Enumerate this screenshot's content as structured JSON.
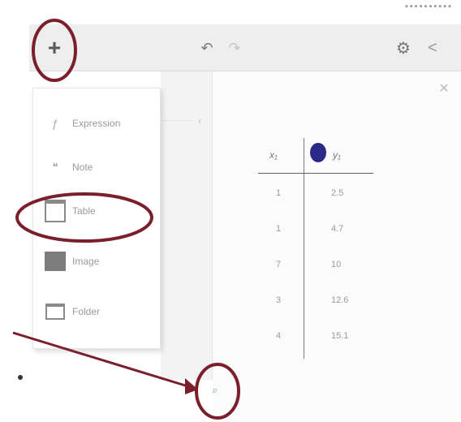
{
  "window": {
    "top_strip_text": "▪▪▪▪▪▪▪▪▪▪"
  },
  "toolbar": {
    "plus_icon": "plus-icon",
    "undo_icon": "undo-icon",
    "redo_icon": "redo-icon",
    "settings_icon": "gear-icon",
    "share_icon": "share-icon"
  },
  "add_menu": {
    "items": [
      {
        "label": "Expression",
        "icon": "expression-icon"
      },
      {
        "label": "Note",
        "icon": "note-icon"
      },
      {
        "label": "Table",
        "icon": "table-icon"
      },
      {
        "label": "Image",
        "icon": "image-icon"
      },
      {
        "label": "Folder",
        "icon": "folder-icon"
      }
    ]
  },
  "table": {
    "header_x": "x₁",
    "header_y": "y₁",
    "marker_color": "#2b2a8a",
    "rows": [
      {
        "x": "1",
        "y": "2.5"
      },
      {
        "x": "1",
        "y": "4.7"
      },
      {
        "x": "7",
        "y": "10"
      },
      {
        "x": "3",
        "y": "12.6"
      },
      {
        "x": "4",
        "y": "15.1"
      }
    ]
  },
  "annotation_color": "#7a1f2b"
}
